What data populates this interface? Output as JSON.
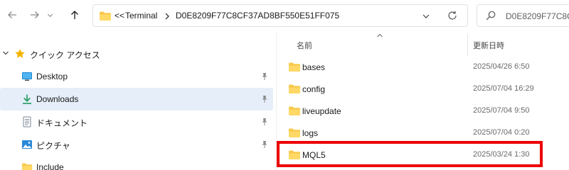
{
  "colors": {
    "selection": "#e5eef9",
    "folder": "#f7c94c",
    "highlight": "#ee0000",
    "accent": "#0067c0"
  },
  "toolbar": {
    "back_icon": "arrow-left-icon",
    "forward_icon": "arrow-right-icon",
    "up_icon": "arrow-up-icon"
  },
  "address": {
    "overflow": "<<",
    "segments": [
      "Terminal",
      "D0E8209F77C8CF37AD8BF550E51FF075"
    ]
  },
  "search": {
    "placeholder": "D0E8209F77C8CF"
  },
  "nav": {
    "items": [
      {
        "label": "クイック アクセス",
        "icon": "star-icon",
        "expanded": true
      },
      {
        "label": "Desktop",
        "icon": "desktop-icon",
        "pinned": true
      },
      {
        "label": "Downloads",
        "icon": "download-icon",
        "pinned": true,
        "selected": true
      },
      {
        "label": "ドキュメント",
        "icon": "document-icon",
        "pinned": true
      },
      {
        "label": "ピクチャ",
        "icon": "pictures-icon",
        "pinned": true
      },
      {
        "label": "Include",
        "icon": "folder-icon"
      }
    ]
  },
  "columns": {
    "name": "名前",
    "date": "更新日時"
  },
  "files": [
    {
      "name": "bases",
      "date": "2025/04/26 6:50"
    },
    {
      "name": "config",
      "date": "2025/07/04 16:29"
    },
    {
      "name": "liveupdate",
      "date": "2025/07/04 9:50"
    },
    {
      "name": "logs",
      "date": "2025/07/04 0:20"
    },
    {
      "name": "MQL5",
      "date": "2025/03/24 1:30",
      "highlighted": true
    }
  ]
}
